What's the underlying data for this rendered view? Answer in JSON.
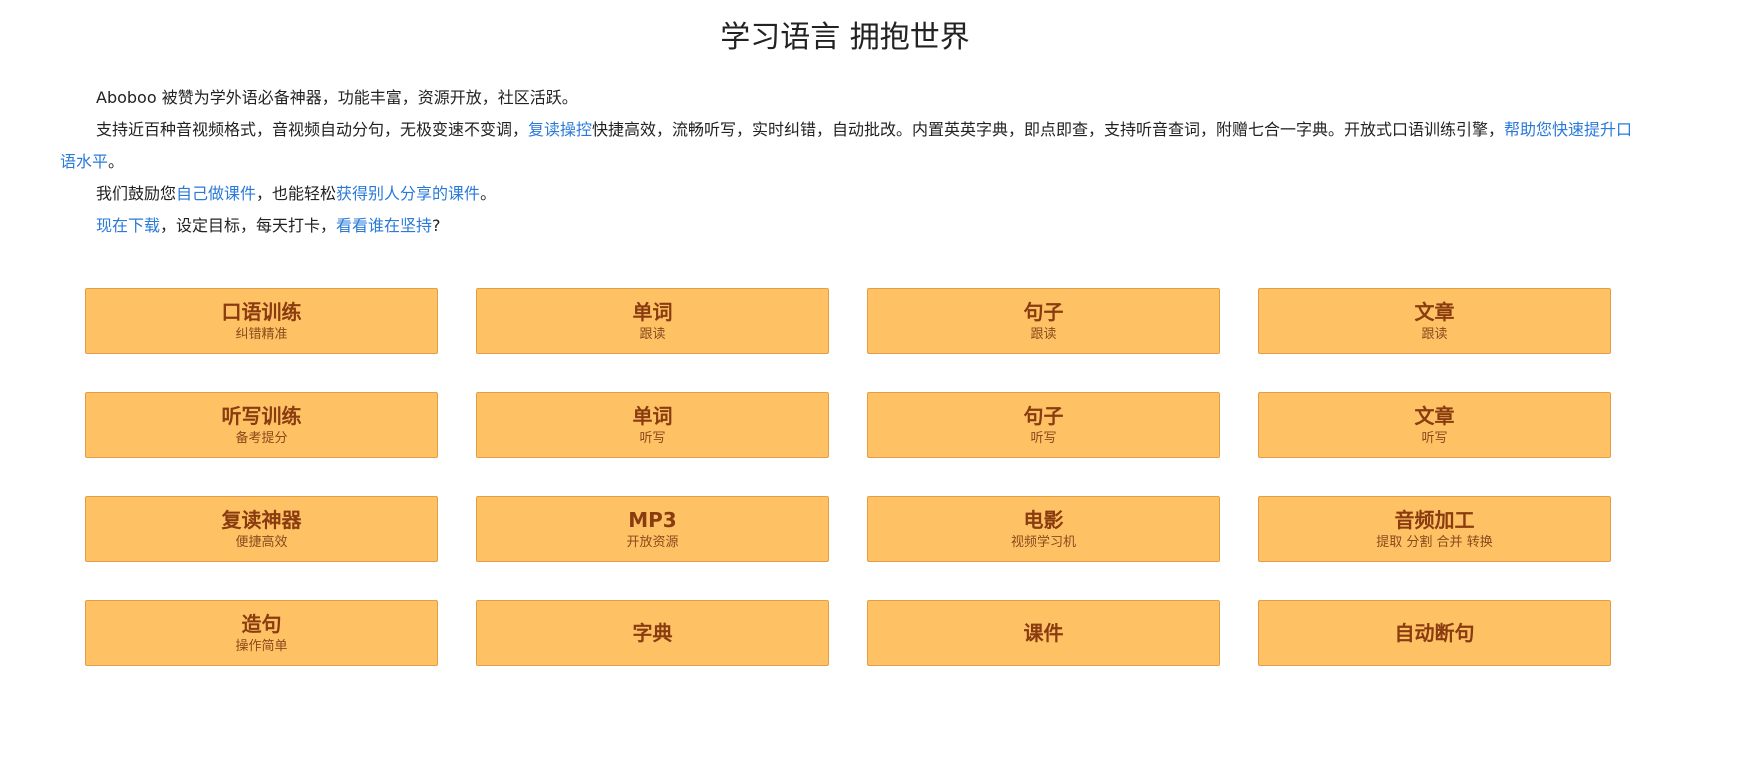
{
  "header": {
    "title": "学习语言 拥抱世界"
  },
  "intro": {
    "line1": "Aboboo 被赞为学外语必备神器，功能丰富，资源开放，社区活跃。",
    "line2": {
      "text_a": "支持近百种音视频格式，音视频自动分句，无极变速不变调，",
      "link_repeat": "复读操控",
      "text_b": "快捷高效，流畅听写，实时纠错，自动批改。内置英英字典，即点即查，支持听音查词，附赠七合一字典。开放式口语训练引擎，",
      "link_speaking": "帮助您快速提升口语水平",
      "text_c": "。"
    },
    "line3": {
      "text_a": "我们鼓励您",
      "link_make": "自己做课件",
      "text_b": "，也能轻松",
      "link_shared": "获得别人分享的课件",
      "text_c": "。"
    },
    "line4": {
      "link_download": "现在下载",
      "text_a": "，设定目标，每天打卡，",
      "link_who": "看看谁在坚持",
      "text_b": "?"
    }
  },
  "features": [
    {
      "title": "口语训练",
      "subtitle": "纠错精准"
    },
    {
      "title": "单词",
      "subtitle": "跟读"
    },
    {
      "title": "句子",
      "subtitle": "跟读"
    },
    {
      "title": "文章",
      "subtitle": "跟读"
    },
    {
      "title": "听写训练",
      "subtitle": "备考提分"
    },
    {
      "title": "单词",
      "subtitle": "听写"
    },
    {
      "title": "句子",
      "subtitle": "听写"
    },
    {
      "title": "文章",
      "subtitle": "听写"
    },
    {
      "title": "复读神器",
      "subtitle": "便捷高效"
    },
    {
      "title": "MP3",
      "subtitle": "开放资源"
    },
    {
      "title": "电影",
      "subtitle": "视频学习机"
    },
    {
      "title": "音频加工",
      "subtitle": "提取 分割 合并 转换"
    },
    {
      "title": "造句",
      "subtitle": "操作简单"
    },
    {
      "title": "字典",
      "subtitle": ""
    },
    {
      "title": "课件",
      "subtitle": ""
    },
    {
      "title": "自动断句",
      "subtitle": ""
    }
  ],
  "colors": {
    "card_background": "#fec265",
    "card_border": "#e59e45",
    "card_title": "#8a3c10",
    "link": "#2a7ad8"
  }
}
